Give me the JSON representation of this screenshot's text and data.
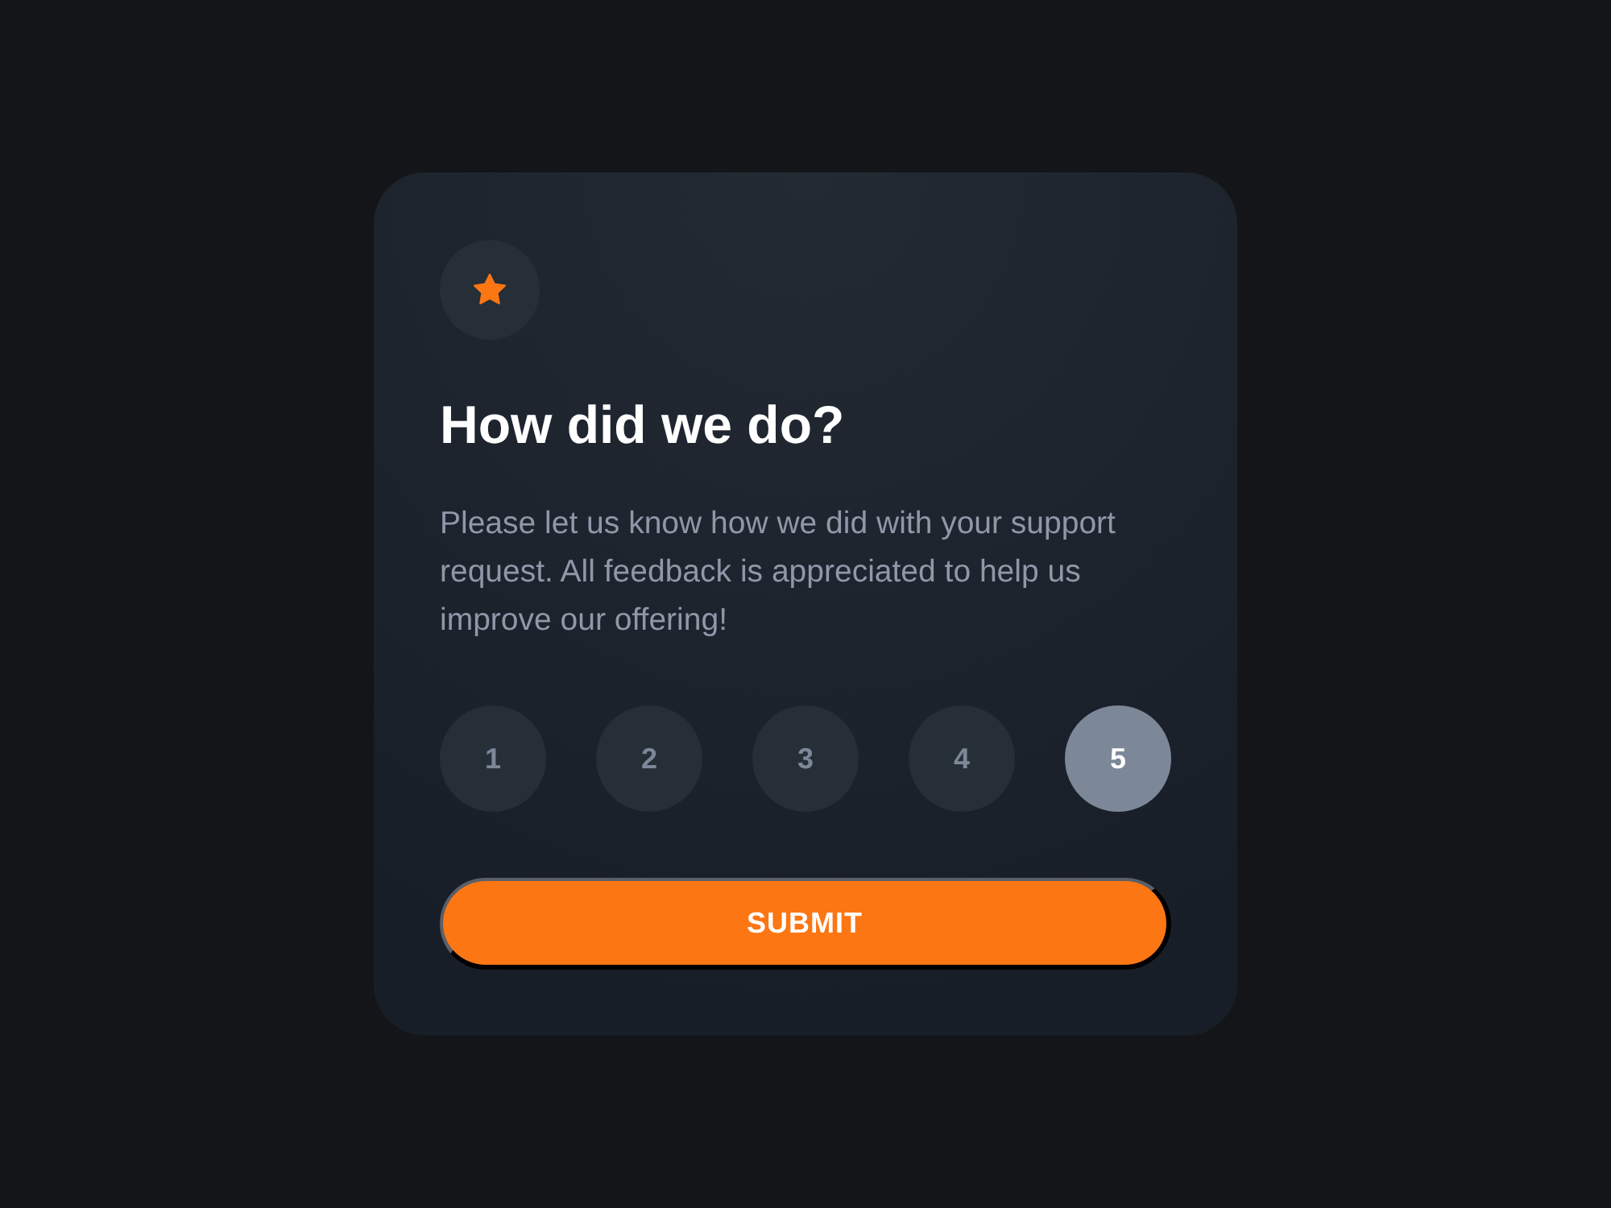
{
  "card": {
    "title": "How did we do?",
    "description": "Please let us know how we did with your support request. All feedback is appreciated to help us improve our offering!"
  },
  "ratings": [
    {
      "label": "1",
      "selected": false
    },
    {
      "label": "2",
      "selected": false
    },
    {
      "label": "3",
      "selected": false
    },
    {
      "label": "4",
      "selected": false
    },
    {
      "label": "5",
      "selected": true
    }
  ],
  "submit_button": {
    "label": "SUBMIT"
  }
}
